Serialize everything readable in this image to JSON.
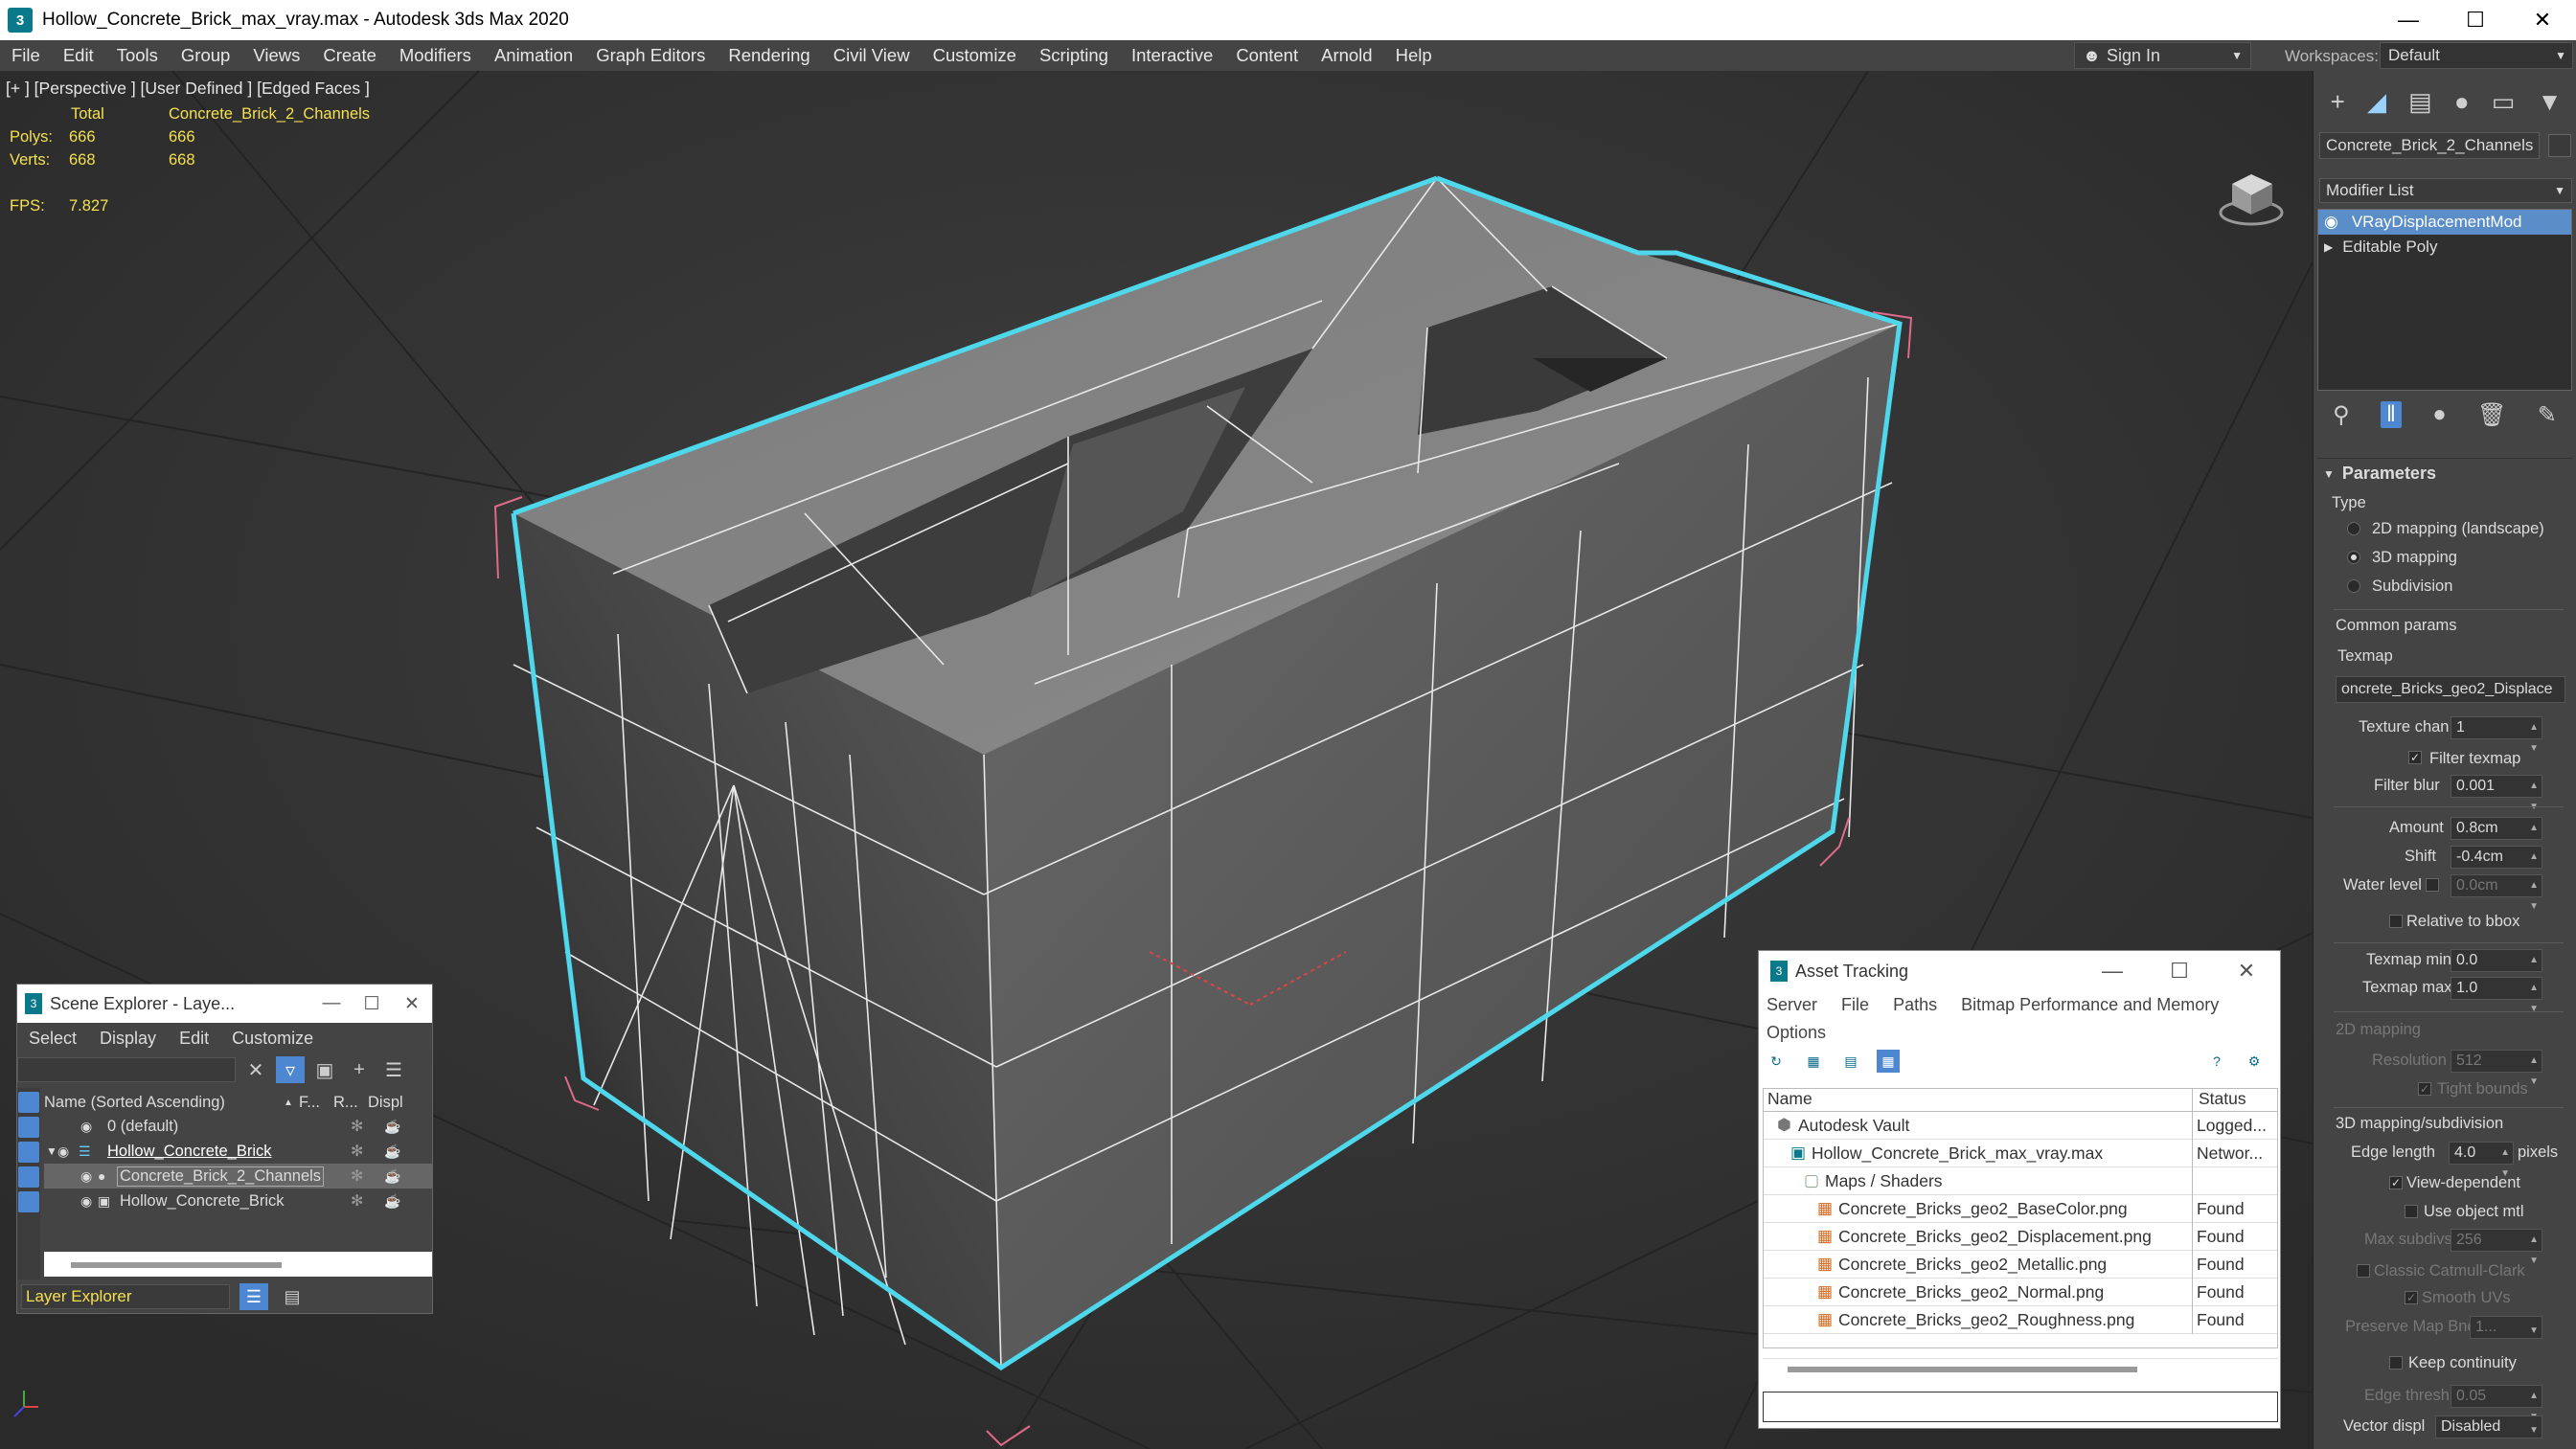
{
  "app": {
    "title": "Hollow_Concrete_Brick_max_vray.max - Autodesk 3ds Max 2020",
    "icon_label": "3",
    "window_buttons": [
      "—",
      "☐",
      "✕"
    ]
  },
  "menu": [
    "File",
    "Edit",
    "Tools",
    "Group",
    "Views",
    "Create",
    "Modifiers",
    "Animation",
    "Graph Editors",
    "Rendering",
    "Civil View",
    "Customize",
    "Scripting",
    "Interactive",
    "Content",
    "Arnold",
    "Help"
  ],
  "signin": {
    "label": "Sign In",
    "icon": "user-icon"
  },
  "workspaces": {
    "label": "Workspaces:",
    "value": "Default"
  },
  "viewport": {
    "label": "[+ ] [Perspective ] [User Defined ] [Edged Faces ]",
    "stats": {
      "total_label": "Total",
      "object_label": "Concrete_Brick_2_Channels",
      "polys_label": "Polys:",
      "polys_total": "666",
      "polys_obj": "666",
      "verts_label": "Verts:",
      "verts_total": "668",
      "verts_obj": "668",
      "fps_label": "FPS:",
      "fps": "7.827"
    },
    "axes": "x y z"
  },
  "command_panel": {
    "tabs": [
      "create-icon",
      "modify-icon",
      "hierarchy-icon",
      "motion-icon",
      "display-icon",
      "utilities-icon"
    ],
    "object_name": "Concrete_Brick_2_Channels",
    "modifier_list": "Modifier List",
    "stack": [
      {
        "label": "VRayDisplacementMod",
        "selected": true
      },
      {
        "label": "Editable Poly",
        "selected": false
      }
    ],
    "rollout": "Parameters",
    "type_label": "Type",
    "type_options": [
      {
        "label": "2D mapping (landscape)",
        "on": false
      },
      {
        "label": "3D mapping",
        "on": true
      },
      {
        "label": "Subdivision",
        "on": false
      }
    ],
    "common_params": "Common params",
    "texmap_label": "Texmap",
    "texmap_value": "oncrete_Bricks_geo2_Displace",
    "texture_chan_label": "Texture chan",
    "texture_chan": "1",
    "filter_texmap": "Filter texmap",
    "filter_blur_label": "Filter blur",
    "filter_blur": "0.001",
    "amount_label": "Amount",
    "amount": "0.8cm",
    "shift_label": "Shift",
    "shift": "-0.4cm",
    "water_level_label": "Water level",
    "water_level": "0.0cm",
    "relative_bbox": "Relative to bbox",
    "texmap_min_label": "Texmap min",
    "texmap_min": "0.0",
    "texmap_max_label": "Texmap max",
    "texmap_max": "1.0",
    "mapping_2d": "2D mapping",
    "resolution_label": "Resolution",
    "resolution": "512",
    "tight_bounds": "Tight bounds",
    "mapping_3d": "3D mapping/subdivision",
    "edge_length_label": "Edge length",
    "edge_length": "4.0",
    "pixels": "pixels",
    "view_dependent": "View-dependent",
    "use_object_mtl": "Use object mtl",
    "max_subdivs_label": "Max subdivs",
    "max_subdivs": "256",
    "classic_catmull": "Classic Catmull-Clark",
    "smooth_uvs": "Smooth UVs",
    "preserve_map_label": "Preserve Map Bnd",
    "preserve_map": "1...",
    "keep_continuity": "Keep continuity",
    "edge_thresh_label": "Edge thresh",
    "edge_thresh": "0.05",
    "vector_displ_label": "Vector displ",
    "vector_displ": "Disabled"
  },
  "scene_explorer": {
    "title": "Scene Explorer - Laye...",
    "menu": [
      "Select",
      "Display",
      "Edit",
      "Customize"
    ],
    "columns": [
      "Name (Sorted Ascending)",
      "F...",
      "R...",
      "Displ"
    ],
    "rows": [
      {
        "name": "0 (default)",
        "indent": 0
      },
      {
        "name": "Hollow_Concrete_Brick",
        "indent": 1
      },
      {
        "name": "Concrete_Brick_2_Channels",
        "indent": 2
      },
      {
        "name": "Hollow_Concrete_Brick",
        "indent": 2
      }
    ],
    "footer": "Layer Explorer"
  },
  "asset_tracking": {
    "title": "Asset Tracking",
    "menu": [
      "Server",
      "File",
      "Paths",
      "Bitmap Performance and Memory",
      "Options"
    ],
    "columns": [
      "Name",
      "Status"
    ],
    "rows": [
      {
        "name": "Autodesk Vault",
        "status": "Logged...",
        "indent": 0,
        "icon": "vault-icon"
      },
      {
        "name": "Hollow_Concrete_Brick_max_vray.max",
        "status": "Networ...",
        "indent": 1,
        "icon": "max-file-icon"
      },
      {
        "name": "Maps / Shaders",
        "status": "",
        "indent": 2,
        "icon": "folder-icon"
      },
      {
        "name": "Concrete_Bricks_geo2_BaseColor.png",
        "status": "Found",
        "indent": 3,
        "icon": "image-icon"
      },
      {
        "name": "Concrete_Bricks_geo2_Displacement.png",
        "status": "Found",
        "indent": 3,
        "icon": "image-icon"
      },
      {
        "name": "Concrete_Bricks_geo2_Metallic.png",
        "status": "Found",
        "indent": 3,
        "icon": "image-icon"
      },
      {
        "name": "Concrete_Bricks_geo2_Normal.png",
        "status": "Found",
        "indent": 3,
        "icon": "image-icon"
      },
      {
        "name": "Concrete_Bricks_geo2_Roughness.png",
        "status": "Found",
        "indent": 3,
        "icon": "image-icon"
      }
    ]
  },
  "colors": {
    "accent": "#4d87d1",
    "selection_outline": "#4fd8ec",
    "stats_text": "#f5e050"
  }
}
